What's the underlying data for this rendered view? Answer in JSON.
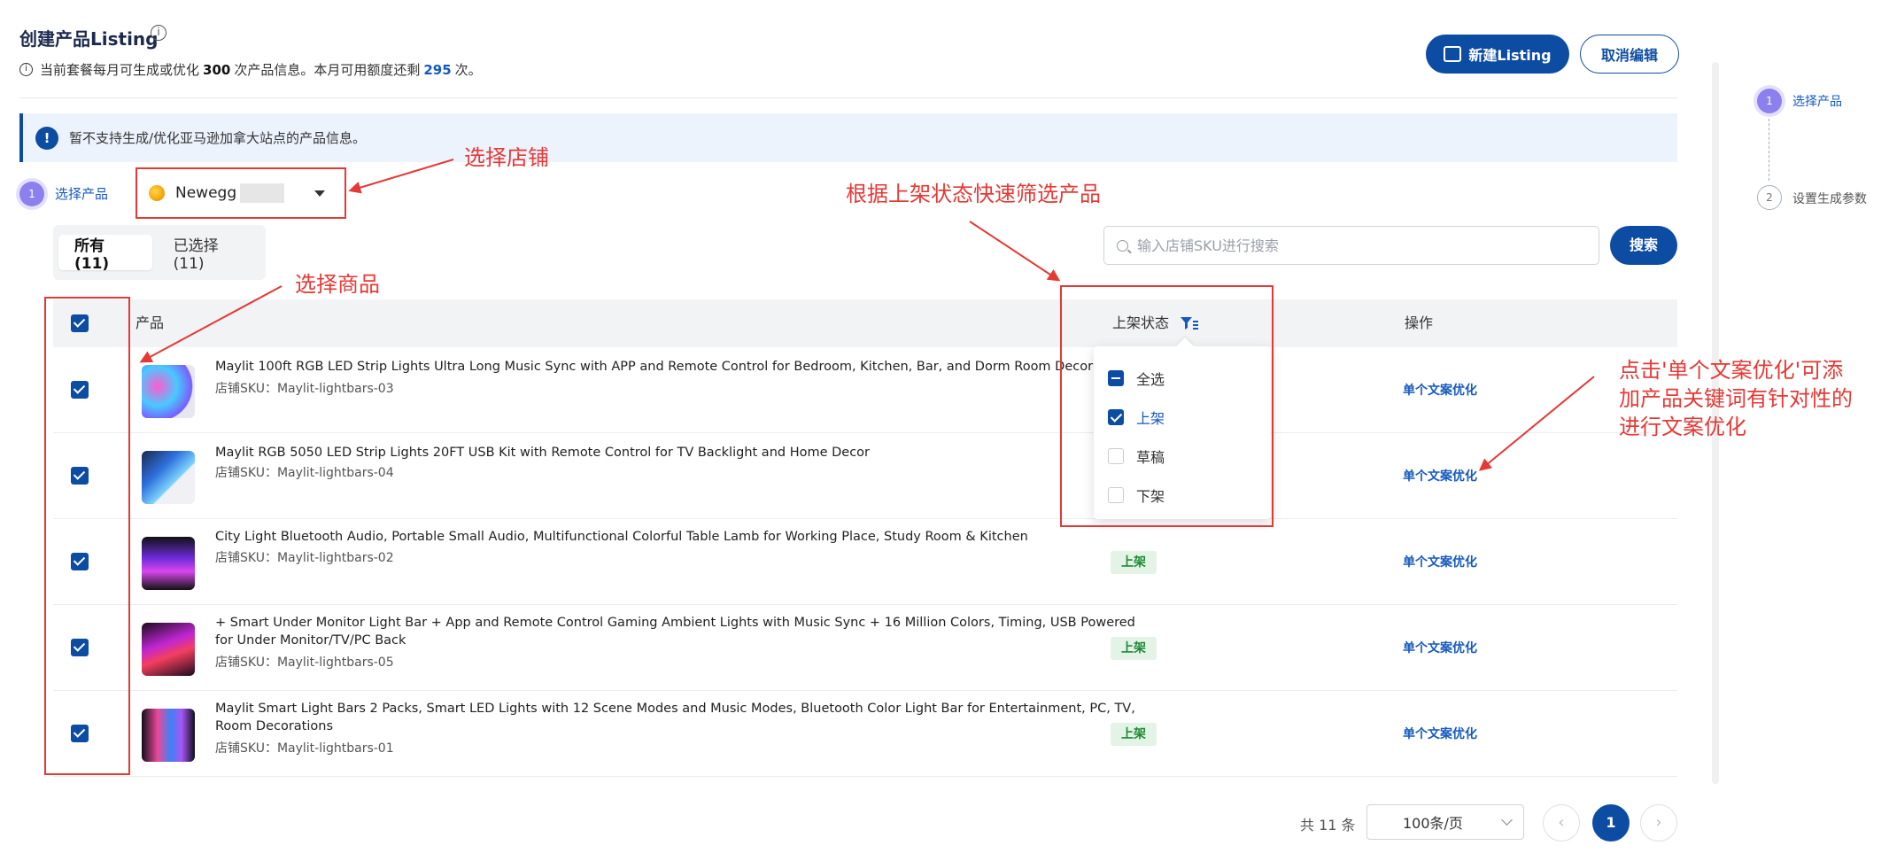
{
  "header": {
    "title": "创建产品Listing",
    "quota_prefix": "当前套餐每月可生成或优化",
    "quota_total": "300",
    "quota_mid": "次产品信息。本月可用额度还剩",
    "quota_remaining": "295",
    "quota_suffix": "次。",
    "new_label": "新建Listing",
    "cancel_label": "取消编辑"
  },
  "alert": {
    "text": "暂不支持生成/优化亚马逊加拿大站点的产品信息。"
  },
  "step": {
    "number": "1",
    "label": "选择产品",
    "store_name": "Newegg"
  },
  "tabs": [
    {
      "label": "所有 (11)"
    },
    {
      "label": "已选择 (11)"
    }
  ],
  "search": {
    "placeholder": "输入店铺SKU进行搜索",
    "button": "搜索"
  },
  "table": {
    "col_product": "产品",
    "col_status": "上架状态",
    "col_action": "操作",
    "rows": [
      {
        "name": "Maylit 100ft RGB LED Strip Lights Ultra Long Music Sync with APP and Remote Control for Bedroom, Kitchen, Bar, and Dorm Room Decor",
        "sku": "店铺SKU：Maylit-lightbars-03",
        "status": "",
        "action": "单个文案优化"
      },
      {
        "name": "Maylit RGB 5050 LED Strip Lights 20FT USB Kit with Remote Control for TV Backlight and Home Decor",
        "sku": "店铺SKU：Maylit-lightbars-04",
        "status": "",
        "action": "单个文案优化"
      },
      {
        "name": "City Light Bluetooth Audio, Portable Small Audio, Multifunctional Colorful Table Lamb for Working Place, Study Room & Kitchen",
        "sku": "店铺SKU：Maylit-lightbars-02",
        "status": "上架",
        "action": "单个文案优化"
      },
      {
        "name": "+ Smart Under Monitor Light Bar + App and Remote Control Gaming Ambient Lights with Music Sync + 16 Million Colors, Timing, USB Powered for Under Monitor/TV/PC Back",
        "sku": "店铺SKU：Maylit-lightbars-05",
        "status": "上架",
        "action": "单个文案优化"
      },
      {
        "name": "Maylit Smart Light Bars 2 Packs, Smart LED Lights with 12 Scene Modes and Music Modes, Bluetooth Color Light Bar for Entertainment, PC, TV, Room Decorations",
        "sku": "店铺SKU：Maylit-lightbars-01",
        "status": "上架",
        "action": "单个文案优化"
      }
    ]
  },
  "filter": {
    "options": [
      {
        "label": "全选",
        "state": "indeterminate"
      },
      {
        "label": "上架",
        "state": "checked"
      },
      {
        "label": "草稿",
        "state": "unchecked"
      },
      {
        "label": "下架",
        "state": "unchecked"
      }
    ]
  },
  "pagination": {
    "total": "共 11 条",
    "page_size": "100条/页",
    "prev": "‹",
    "current": "1",
    "next": "›"
  },
  "steps_panel": [
    {
      "number": "1",
      "label": "选择产品"
    },
    {
      "number": "2",
      "label": "设置生成参数"
    }
  ],
  "annotations": {
    "store": "选择店铺",
    "filter": "根据上架状态快速筛选产品",
    "products": "选择商品",
    "optimize_line1": "点击'单个文案优化'可添",
    "optimize_line2": "加产品关键词有针对性的",
    "optimize_line3": "进行文案优化"
  },
  "colors": {
    "primary": "#0d4ca3",
    "annotation_red": "#e53935",
    "step_purple": "#8c80ee"
  }
}
